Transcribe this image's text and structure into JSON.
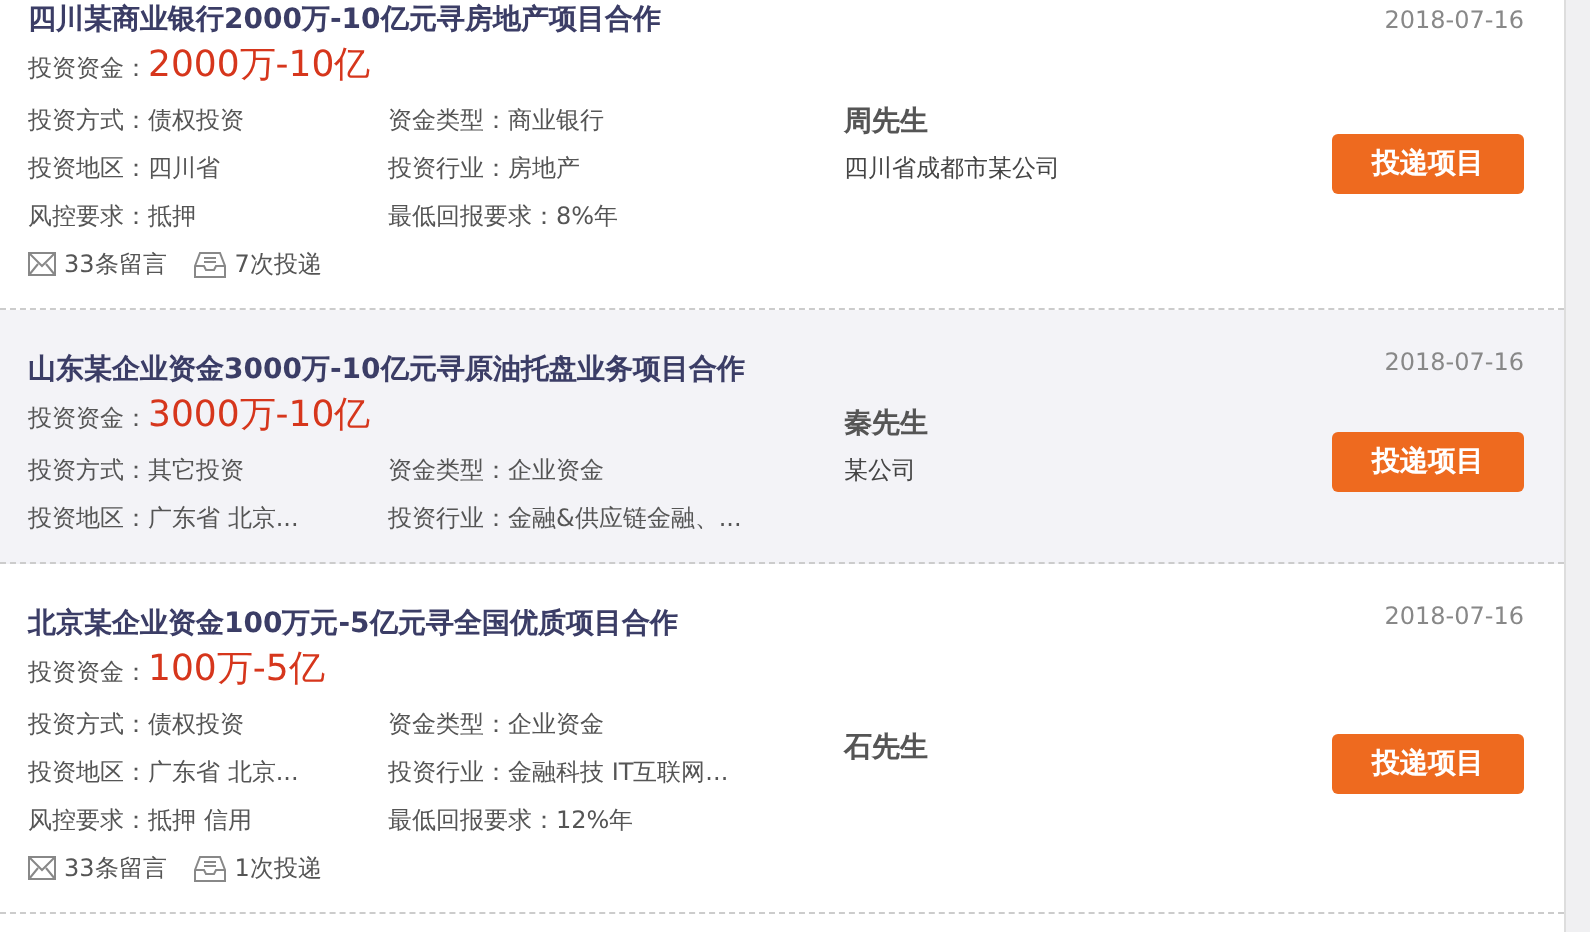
{
  "projects": [
    {
      "title": "四川某商业银行2000万-10亿元寻房地产项目合作",
      "date": "2018-07-16",
      "amount_label": "投资资金：",
      "amount": "2000万-10亿",
      "highlighted": false,
      "fields": [
        {
          "label": "投资方式：",
          "value": "债权投资"
        },
        {
          "label": "资金类型：",
          "value": "商业银行"
        },
        {
          "label": "投资地区：",
          "value": "四川省"
        },
        {
          "label": "投资行业：",
          "value": "房地产"
        },
        {
          "label": "风控要求：",
          "value": "抵押"
        },
        {
          "label": "最低回报要求：",
          "value": "8%年"
        }
      ],
      "comments": "33条留言",
      "deliveries": "7次投递",
      "contact": "周先生",
      "company": "四川省成都市某公司",
      "button": "投递项目"
    },
    {
      "title": "山东某企业资金3000万-10亿元寻原油托盘业务项目合作",
      "date": "2018-07-16",
      "amount_label": "投资资金：",
      "amount": "3000万-10亿",
      "highlighted": true,
      "fields": [
        {
          "label": "投资方式：",
          "value": "其它投资"
        },
        {
          "label": "资金类型：",
          "value": "企业资金"
        },
        {
          "label": "投资地区：",
          "value": "广东省 北京..."
        },
        {
          "label": "投资行业：",
          "value": "金融&供应链金融、..."
        }
      ],
      "contact": "秦先生",
      "company": "某公司",
      "button": "投递项目"
    },
    {
      "title": "北京某企业资金100万元-5亿元寻全国优质项目合作",
      "date": "2018-07-16",
      "amount_label": "投资资金：",
      "amount": "100万-5亿",
      "highlighted": false,
      "fields": [
        {
          "label": "投资方式：",
          "value": "债权投资"
        },
        {
          "label": "资金类型：",
          "value": "企业资金"
        },
        {
          "label": "投资地区：",
          "value": "广东省 北京..."
        },
        {
          "label": "投资行业：",
          "value": "金融科技 IT互联网..."
        },
        {
          "label": "风控要求：",
          "value": "抵押 信用"
        },
        {
          "label": "最低回报要求：",
          "value": "12%年"
        }
      ],
      "comments": "33条留言",
      "deliveries": "1次投递",
      "contact": "石先生",
      "button": "投递项目"
    }
  ]
}
